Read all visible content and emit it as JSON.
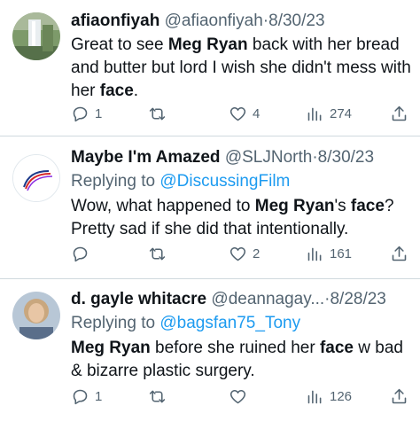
{
  "tweets": [
    {
      "name": "afiaonfiyah",
      "handle": "@afiaonfiyah",
      "separator": "·",
      "date": "8/30/23",
      "reply_prefix": "",
      "reply_to": "",
      "text": [
        {
          "t": "Great to see ",
          "b": false
        },
        {
          "t": "Meg Ryan",
          "b": true
        },
        {
          "t": " back with her bread and butter but lord I wish she didn't mess with her ",
          "b": false
        },
        {
          "t": "face",
          "b": true
        },
        {
          "t": ".",
          "b": false
        }
      ],
      "replies": "1",
      "retweets": "",
      "likes": "4",
      "views": "274",
      "avatar_colors": [
        "#6f8a5e",
        "#b9c7a8",
        "#e8eef2"
      ]
    },
    {
      "name": "Maybe I'm Amazed",
      "handle": "@SLJNorth",
      "separator": "·",
      "date": "8/30/23",
      "reply_prefix": "Replying to ",
      "reply_to": "@DiscussingFilm",
      "text": [
        {
          "t": "Wow, what happened to ",
          "b": false
        },
        {
          "t": "Meg Ryan",
          "b": true
        },
        {
          "t": "'s ",
          "b": false
        },
        {
          "t": "face",
          "b": true
        },
        {
          "t": "? Pretty sad if she did that intentionally.",
          "b": false
        }
      ],
      "replies": "",
      "retweets": "",
      "likes": "2",
      "views": "161",
      "avatar_colors": [
        "#ffffff",
        "#d62828",
        "#1d3a8a"
      ]
    },
    {
      "name": "d. gayle whitacre",
      "handle": "@deannagay...",
      "separator": "·",
      "date": "8/28/23",
      "reply_prefix": "Replying to ",
      "reply_to": "@bagsfan75_Tony",
      "text": [
        {
          "t": "Meg Ryan",
          "b": true
        },
        {
          "t": " before she ruined her ",
          "b": false
        },
        {
          "t": "face",
          "b": true
        },
        {
          "t": " w bad & bizarre plastic surgery.",
          "b": false
        }
      ],
      "replies": "1",
      "retweets": "",
      "likes": "",
      "views": "126",
      "avatar_colors": [
        "#c9b89a",
        "#8a6a4e",
        "#7a9bb8"
      ]
    }
  ],
  "icons": {
    "reply": "reply-icon",
    "retweet": "retweet-icon",
    "like": "heart-icon",
    "views": "views-icon",
    "share": "share-icon"
  },
  "colors": {
    "text": "#0f1419",
    "secondary": "#536471",
    "link": "#1d9bf0",
    "divider": "#cfd9de"
  }
}
